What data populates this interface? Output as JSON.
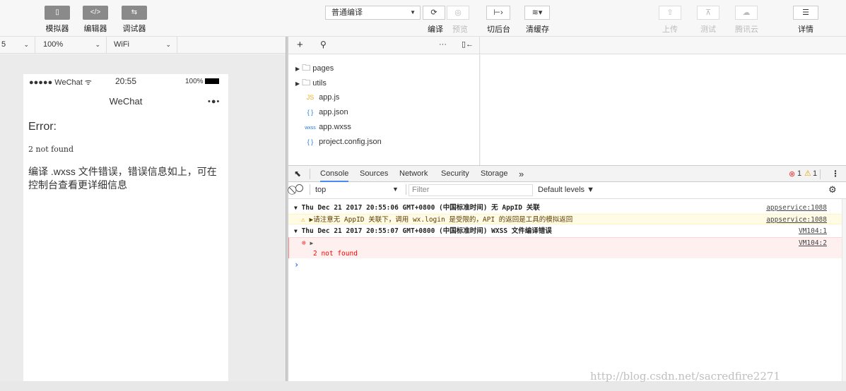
{
  "toolbar": {
    "simulator_label": "模拟器",
    "editor_label": "编辑器",
    "debugger_label": "调试器",
    "simulator_icon": "▯",
    "editor_icon": "</>",
    "debugger_icon": "⇆",
    "compile_mode": "普通编译",
    "compile_label": "编译",
    "preview_label": "预览",
    "background_label": "切后台",
    "clear_cache_label": "清缓存",
    "upload_label": "上传",
    "test_label": "测试",
    "tencent_cloud_label": "腾讯云",
    "details_label": "详情"
  },
  "subbar": {
    "device_suffix": "5",
    "zoom": "100%",
    "network": "WiFi"
  },
  "phone": {
    "carrier": "●●●●● WeChat",
    "time": "20:55",
    "battery": "100%",
    "nav_title": "WeChat",
    "menu_dots": "•●•",
    "error_heading": "Error:",
    "error_code": "2 not found",
    "error_message": "编译 .wxss 文件错误，错误信息如上，可在控制台查看更详细信息"
  },
  "files": {
    "toolbar_more": "···",
    "items": [
      {
        "icon": "▸ ☐",
        "name": "pages"
      },
      {
        "icon": "▸ ☐",
        "name": "utils"
      },
      {
        "icon": "JS",
        "name": "app.js"
      },
      {
        "icon": "{ }",
        "name": "app.json"
      },
      {
        "icon": "wxss",
        "name": "app.wxss"
      },
      {
        "icon": "{ }",
        "name": "project.config.json"
      }
    ]
  },
  "devtools": {
    "tabs": [
      "Console",
      "Sources",
      "Network",
      "Security",
      "Storage"
    ],
    "more_tabs": "»",
    "error_count": "1",
    "warning_count": "1",
    "context": "top",
    "filter_placeholder": "Filter",
    "levels": "Default levels ▼"
  },
  "console": {
    "group1_title": "Thu Dec 21 2017 20:55:06 GMT+0800 (中国标准时间) 无 AppID 关联",
    "group1_source": "appservice:1088",
    "warning_text": "▶请注意无 AppID 关联下，调用 wx.login 是受限的，API 的返回是工具的模拟返回",
    "warning_source": "appservice:1088",
    "group2_title": "Thu Dec 21 2017 20:55:07 GMT+0800 (中国标准时间)  WXSS 文件编译错误",
    "group2_source": "VM104:1",
    "error_arrow": "▶",
    "error_source": "VM104:2",
    "error_text": "2 not found",
    "prompt": "›"
  },
  "watermark": "http://blog.csdn.net/sacredfire2271"
}
